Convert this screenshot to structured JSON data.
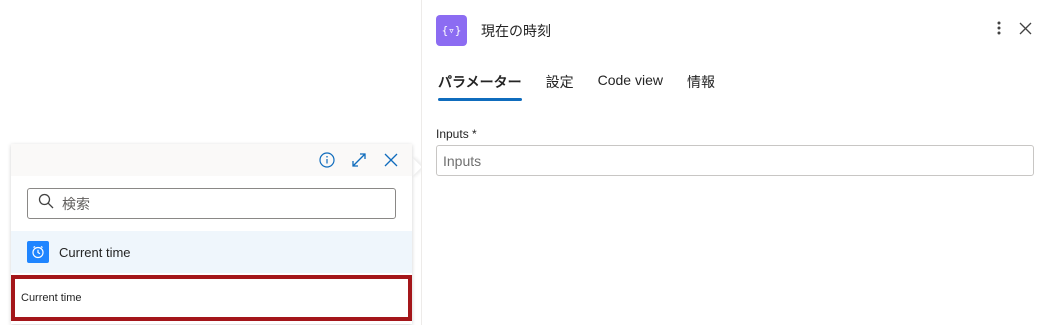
{
  "flyout": {
    "header_icons": [
      "info-icon",
      "expand-icon",
      "close-icon"
    ],
    "search": {
      "placeholder": "検索",
      "value": ""
    },
    "result": {
      "label": "Current time",
      "icon": "clock-icon",
      "badge_color": "#1f85ff"
    },
    "selected": {
      "label": "Current time",
      "highlight_color": "#a4161a"
    }
  },
  "details": {
    "title": "現在の時刻",
    "badge_text": "{▿}",
    "badge_color": "#8c6cf2",
    "tabs": [
      {
        "label": "パラメーター",
        "active": true
      },
      {
        "label": "設定",
        "active": false
      },
      {
        "label": "Code view",
        "active": false
      },
      {
        "label": "情報",
        "active": false
      }
    ],
    "field": {
      "label": "Inputs *",
      "placeholder": "Inputs",
      "value": ""
    }
  },
  "colors": {
    "accent": "#0f6cbd"
  }
}
